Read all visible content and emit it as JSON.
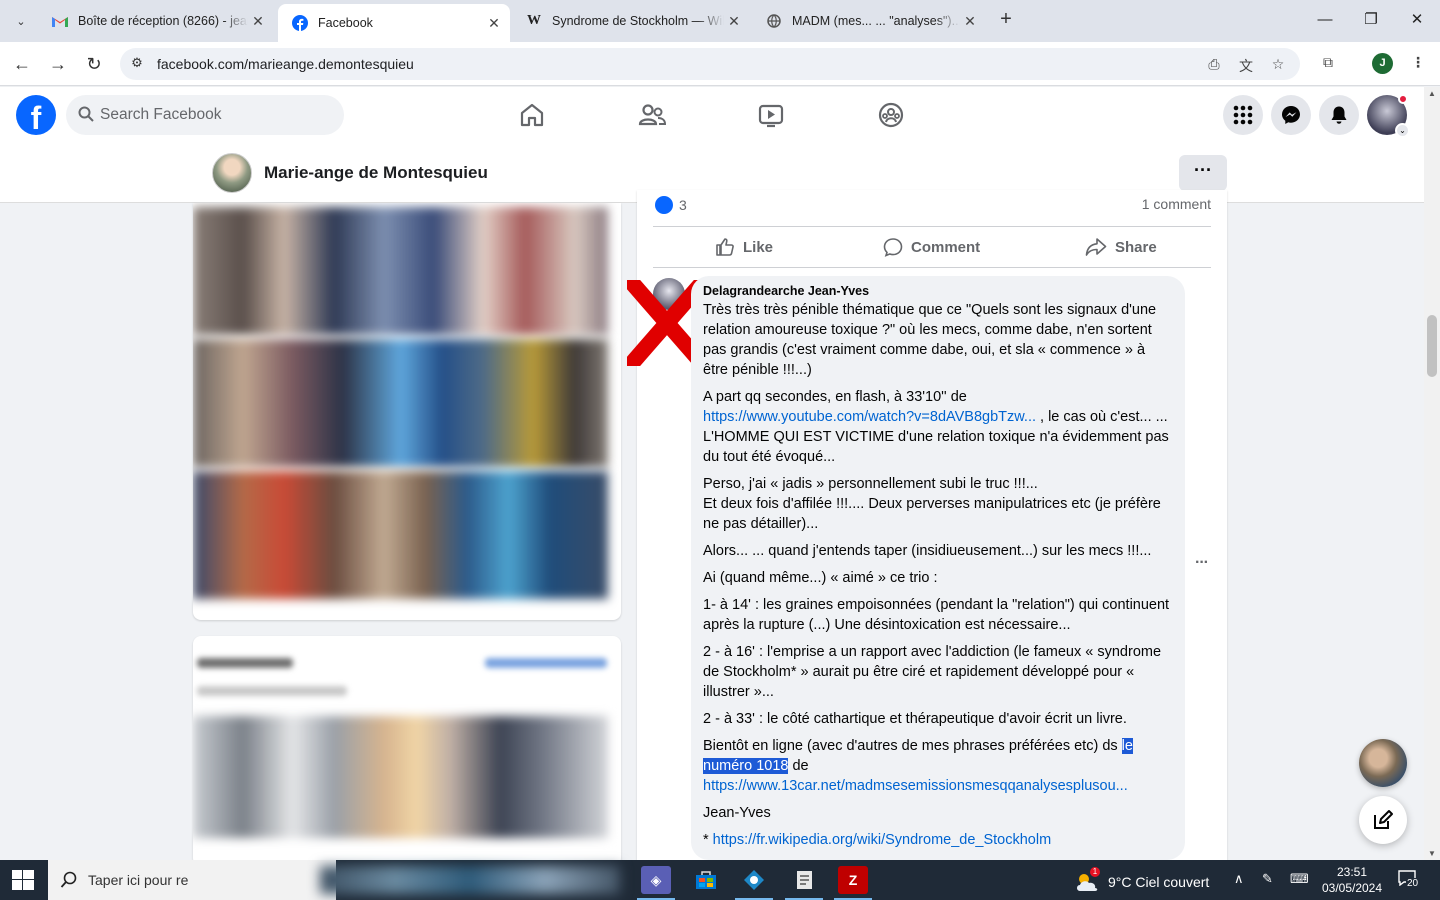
{
  "browser": {
    "tabs": [
      {
        "title": "Boîte de réception (8266) - jean",
        "icon": "gmail-icon"
      },
      {
        "title": "Facebook",
        "icon": "facebook-icon",
        "active": true
      },
      {
        "title": "Syndrome de Stockholm — Wiki",
        "icon": "wikipedia-icon"
      },
      {
        "title": "MADM (mes... ... \"analyses\")....",
        "icon": "globe-icon"
      }
    ],
    "url": "facebook.com/marieange.demontesquieu",
    "profile_initial": "J"
  },
  "facebook": {
    "logo_letter": "f",
    "search_placeholder": "Search Facebook"
  },
  "profile": {
    "name": "Marie-ange de Montesquieu",
    "more": "···"
  },
  "post": {
    "reaction_count": "3",
    "comment_count": "1 comment",
    "actions": {
      "like": "Like",
      "comment": "Comment",
      "share": "Share"
    }
  },
  "comment": {
    "author": "Delagrandearche Jean-Yves",
    "p1": "Très très très pénible thématique que ce \"Quels sont les signaux d'une relation amoureuse toxique ?\" où les mecs, comme dabe, n'en sortent pas grandis (c'est vraiment comme dabe, oui, et sla « commence » à être pénible !!!...)",
    "p2_a": "A part qq secondes, en flash, à 33'10'' de",
    "p2_link": "https://www.youtube.com/watch?v=8dAVB8gbTzw...",
    "p2_b": ", le cas où c'est... ... L'HOMME QUI EST VICTIME d'une relation toxique n'a évidemment pas du tout été évoqué...",
    "p3_a": "Perso, j'ai « jadis » personnellement subi le truc !!!...",
    "p3_b": "Et deux fois d'affilée !!!.... Deux perverses manipulatrices etc (je préfère ne pas détailler)...",
    "p4": "Alors... ... quand j'entends taper (insidiueusement...) sur les mecs !!!...",
    "p5": "Ai (quand même...) « aimé » ce trio :",
    "p6": "1- à 14' : les graines empoisonnées (pendant la \"relation\") qui continuent après la rupture (...) Une désintoxication est nécessaire...",
    "p7": "2 - à 16' : l'emprise a un rapport avec l'addiction (le fameux « syndrome de Stockholm* » aurait pu être ciré et rapidement développé pour « illustrer »...",
    "p8": "2 - à 33' : le côté cathartique et thérapeutique d'avoir écrit un livre.",
    "p9_a": "Bientôt en ligne (avec d'autres de mes phrases préférées etc) ds ",
    "p9_sel": "le numéro 1018",
    "p9_b": " de",
    "p9_link": "https://www.13car.net/madmsesemissionsmesqqanalysesplusou...",
    "p10": "Jean-Yves",
    "p11_a": "* ",
    "p11_link": "https://fr.wikipedia.org/wiki/Syndrome_de_Stockholm",
    "more": "···"
  },
  "taskbar": {
    "search_placeholder": "Taper ici pour re",
    "weather": "9°C  Ciel couvert",
    "weather_badge": "1",
    "time": "23:51",
    "date": "03/05/2024",
    "notifications": "20"
  },
  "colors": {
    "fb_blue": "#0866ff",
    "link": "#0064d1",
    "selection": "#1d5ad6",
    "red_x": "#e00000"
  }
}
